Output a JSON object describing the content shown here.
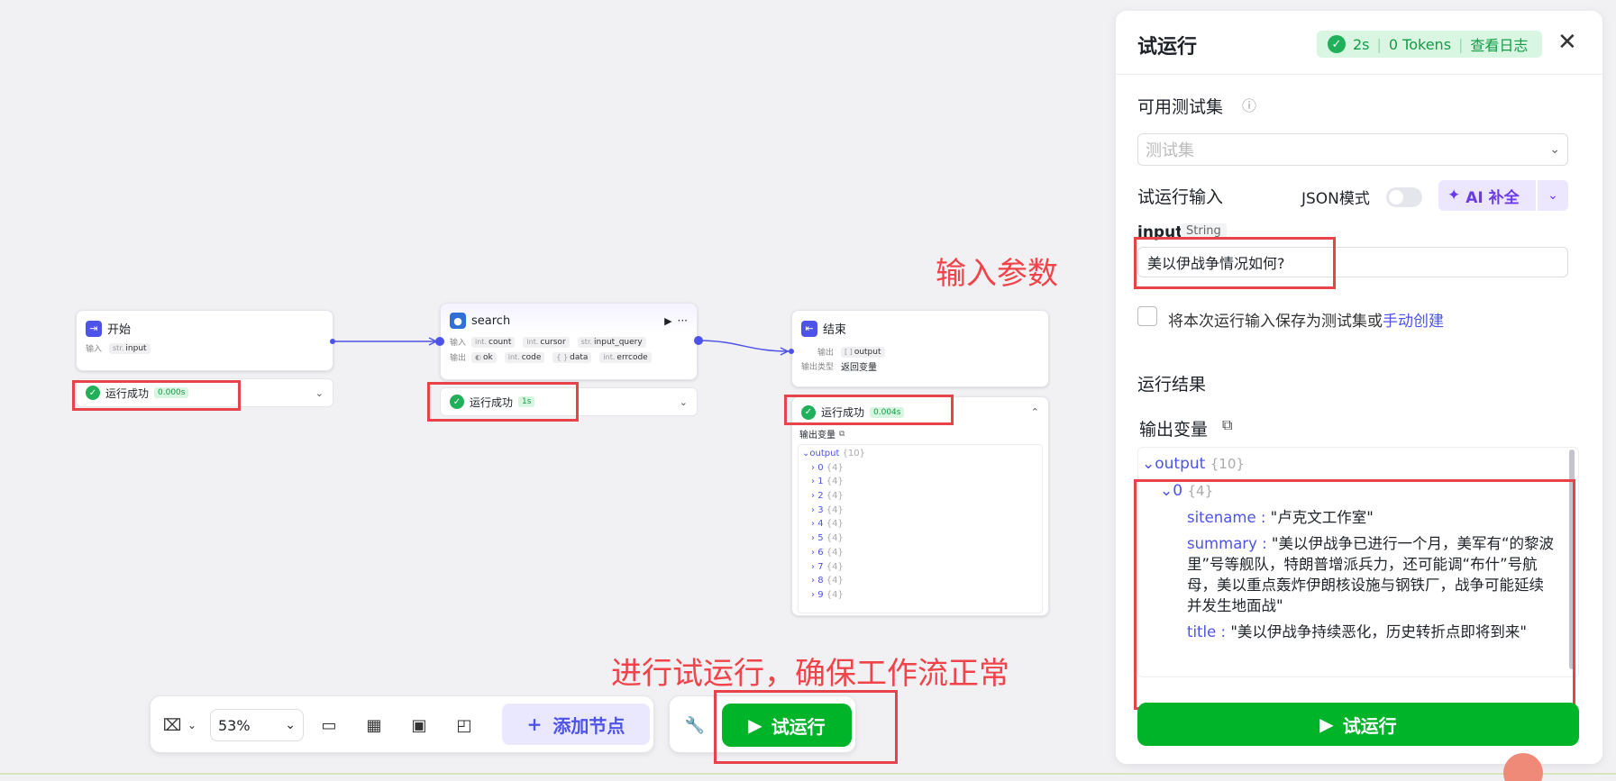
{
  "canvas": {
    "annotations": {
      "input_params": "输入参数",
      "trial_run_hint": "进行试运行，确保工作流正常"
    },
    "start_node": {
      "title": "开始",
      "input_label": "输入",
      "input_var_type": "str.",
      "input_var": "input",
      "status": "运行成功",
      "duration": "0.000s"
    },
    "search_node": {
      "title": "search",
      "input_label": "输入",
      "output_label": "输出",
      "inputs": [
        {
          "type": "int.",
          "name": "count"
        },
        {
          "type": "int.",
          "name": "cursor"
        },
        {
          "type": "str.",
          "name": "input_query"
        }
      ],
      "outputs": [
        {
          "type": "",
          "name": "ok"
        },
        {
          "type": "int.",
          "name": "code"
        },
        {
          "type": "{ }",
          "name": "data"
        },
        {
          "type": "int.",
          "name": "errcode"
        }
      ],
      "more": "···",
      "status": "运行成功",
      "duration": "1s"
    },
    "end_node": {
      "title": "结束",
      "output_label": "输出",
      "output_var_type": "[ ]",
      "output_var": "output",
      "output_type_label": "输出类型",
      "output_type_value": "返回变量",
      "status": "运行成功",
      "duration": "0.004s",
      "output_vars_label": "输出变量",
      "tree_root": "output",
      "tree_root_count": "{10}",
      "tree_items": [
        {
          "key": "0",
          "count": "{4}"
        },
        {
          "key": "1",
          "count": "{4}"
        },
        {
          "key": "2",
          "count": "{4}"
        },
        {
          "key": "3",
          "count": "{4}"
        },
        {
          "key": "4",
          "count": "{4}"
        },
        {
          "key": "5",
          "count": "{4}"
        },
        {
          "key": "6",
          "count": "{4}"
        },
        {
          "key": "7",
          "count": "{4}"
        },
        {
          "key": "8",
          "count": "{4}"
        },
        {
          "key": "9",
          "count": "{4}"
        }
      ]
    }
  },
  "toolbar": {
    "zoom": "53%",
    "add_node": "添加节点",
    "trial_run": "试运行"
  },
  "panel": {
    "title": "试运行",
    "duration": "2s",
    "tokens": "0 Tokens",
    "view_log": "查看日志",
    "testset_label": "可用测试集",
    "testset_placeholder": "测试集",
    "trial_input_label": "试运行输入",
    "json_mode": "JSON模式",
    "ai_fill": "AI 补全",
    "input_name": "input",
    "input_type": "String",
    "input_value": "美以伊战争情况如何?",
    "save_text": "将本次运行输入保存为测试集或",
    "manual_create": "手动创建",
    "result_label": "运行结果",
    "output_vars_label": "输出变量",
    "output_root": "output",
    "output_root_count": "{10}",
    "item0_key": "0",
    "item0_count": "{4}",
    "sitename_key": "sitename",
    "sitename_value": "\"卢克文工作室\"",
    "summary_key": "summary",
    "summary_value": "\"美以伊战争已进行一个月，美军有“的黎波里”号等舰队，特朗普增派兵力，还可能调“布什”号航母，美以重点轰炸伊朗核设施与钢铁厂，战争可能延续并发生地面战\"",
    "title_key": "title",
    "title_value": "\"美以伊战争持续恶化，历史转折点即将到来\"",
    "run_button": "试运行"
  },
  "colors": {
    "accent": "#4d53e8",
    "success": "#00b42a",
    "annotation": "#f0444a"
  }
}
